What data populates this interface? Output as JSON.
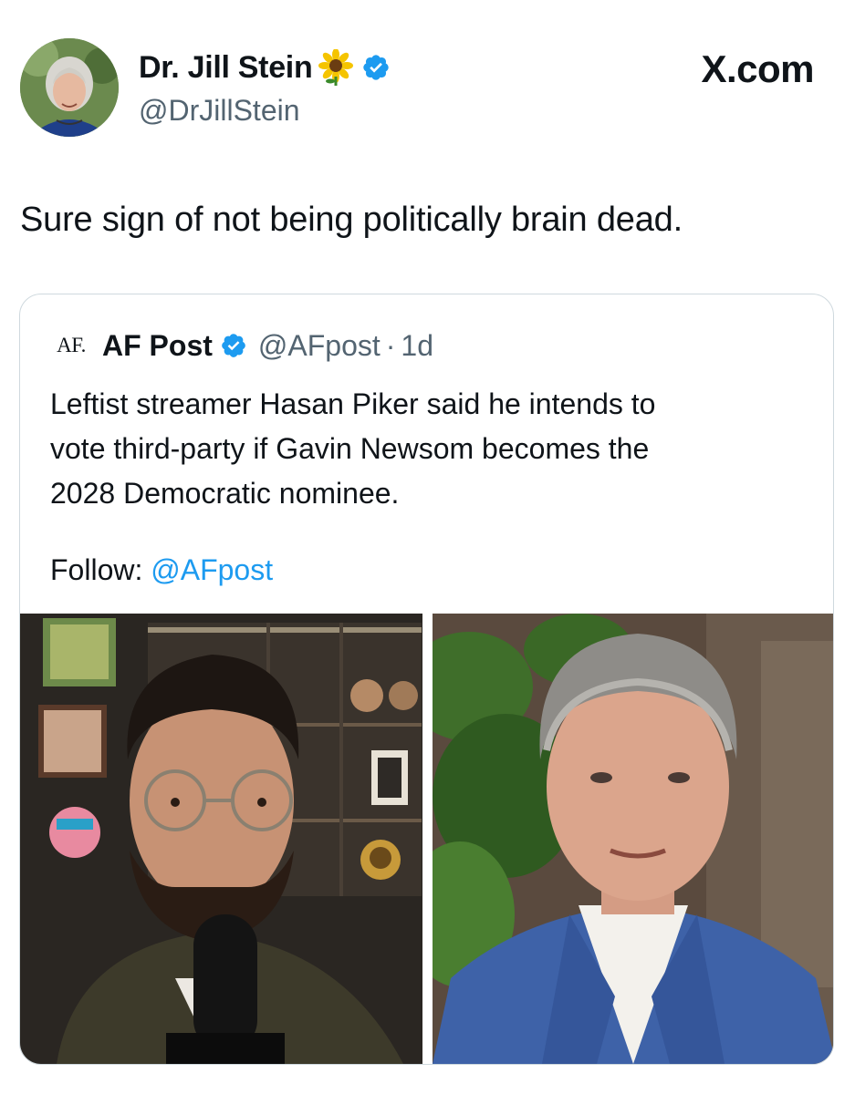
{
  "tweet": {
    "author": {
      "name": "Dr. Jill Stein",
      "name_emoji": "sunflower-icon",
      "verified_icon": "verified-badge-icon",
      "handle": "@DrJillStein"
    },
    "source_label": "X.com",
    "text": "Sure sign of not being politically brain dead."
  },
  "quoted_tweet": {
    "avatar_text": "AF.",
    "name": "AF Post",
    "verified_icon": "verified-badge-icon",
    "handle": "@AFpost",
    "separator": "·",
    "time": "1d",
    "text_lines": [
      "Leftist streamer Hasan Piker said he intends to",
      "vote third-party if Gavin Newsom becomes the",
      "2028 Democratic nominee."
    ],
    "follow_label": "Follow: ",
    "follow_mention": "@AFpost",
    "images": [
      "streamer-photo",
      "politician-photo"
    ]
  },
  "colors": {
    "text": "#0f1419",
    "secondary": "#536471",
    "link": "#1d9bf0",
    "verified": "#1d9bf0",
    "border": "#cfd9de"
  }
}
